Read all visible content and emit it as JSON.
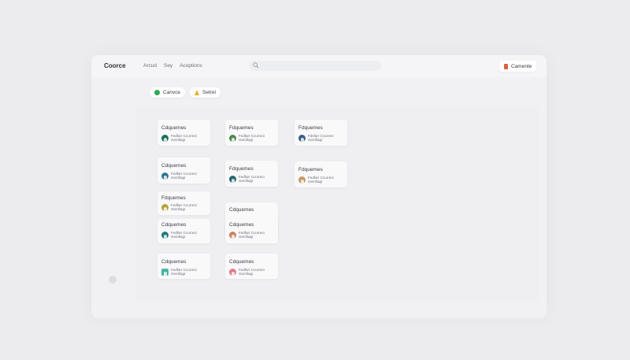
{
  "app": {
    "brand": "Coorce"
  },
  "nav": [
    "Arcud",
    "Sey",
    "Acoptions"
  ],
  "search": {
    "placeholder": ""
  },
  "account": {
    "label": "Camente"
  },
  "chips": [
    {
      "label": "Canvce",
      "icon": "check-circle-icon"
    },
    {
      "label": "Setrel",
      "icon": "warning-icon"
    }
  ],
  "cards": [
    {
      "title": "Cdquemes",
      "line1": "Fedfarr Ccurrect",
      "line2": "Gemfiagr",
      "avatar_color": "#1f6f5c"
    },
    {
      "title": "Fdquemes",
      "line1": "Fedfarr Ccurrect",
      "line2": "Gemfiagr",
      "avatar_color": "#4a8a4f"
    },
    {
      "title": "Fdquemes",
      "line1": "Fdsfarr Ccurrect",
      "line2": "Gemfiagr",
      "avatar_color": "#3b5f8a"
    },
    {
      "title": "Cdquemes",
      "line1": "Fedfarr Ccurrect",
      "line2": "Gemfiagr",
      "avatar_color": "#2e7a8c"
    },
    {
      "title": "Fdquemes",
      "line1": "Fedfarr Ccurrect",
      "line2": "Gemfiagr",
      "avatar_color": "#27666e"
    },
    {
      "title": "Fdquemes",
      "line1": "Fedfarr Ccurrect",
      "line2": "Gemfiagr",
      "avatar_color": "#c79a62"
    },
    {
      "title": "Fdquemes",
      "line1": "Fedfarr Ccurrect",
      "line2": "Gemfiagr",
      "avatar_color": "#b7a23a"
    },
    {
      "title": "Cdquemes",
      "line1": "",
      "line2": "",
      "avatar_color": ""
    },
    {
      "title": "Cdquemes",
      "line1": "Fedfarr Ccurrect",
      "line2": "Gemfiagr",
      "avatar_color": "#1f7a78"
    },
    {
      "title": "Cdquemes",
      "line1": "Fedfarr Ccurrect",
      "line2": "Gemfiagr",
      "avatar_color": "#c9835f"
    },
    {
      "title": "Cdquemes",
      "line1": "Fedfarr Ccurrect",
      "line2": "Gemfiagr",
      "avatar_color": "#48b5a3"
    },
    {
      "title": "Cdquemes",
      "line1": "Fedfarr Ccurrect",
      "line2": "Gemfiagr",
      "avatar_color": "#e07a8a"
    }
  ]
}
